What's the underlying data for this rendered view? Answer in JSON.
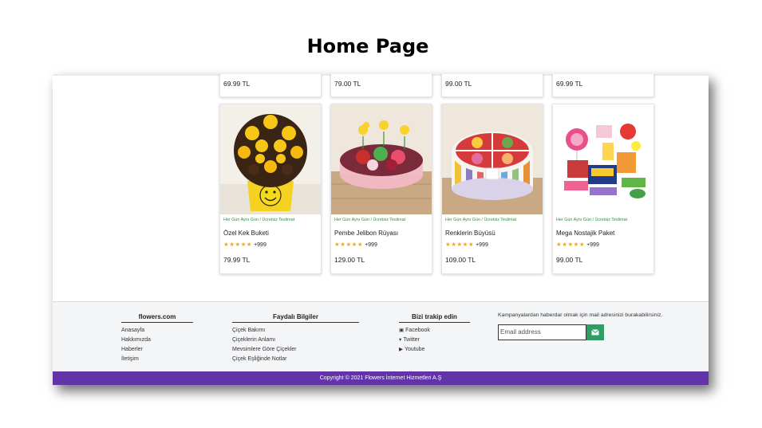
{
  "slide": {
    "title": "Home Page"
  },
  "top_row": [
    {
      "price": "69.99 TL"
    },
    {
      "price": "79.00 TL"
    },
    {
      "price": "99.00 TL"
    },
    {
      "price": "69.99 TL"
    }
  ],
  "products": [
    {
      "shipping": "Her Gün Aynı Gün / Ücretsiz Teslimat",
      "name": "Özel Kek Buketi",
      "stars": "★★★★★",
      "reviews": "+999",
      "price": "79.99 TL"
    },
    {
      "shipping": "Her Gün Aynı Gün / Ücretsiz Teslimat",
      "name": "Pembe Jelibon Rüyası",
      "stars": "★★★★★",
      "reviews": "+999",
      "price": "129.00 TL"
    },
    {
      "shipping": "Her Gün Aynı Gün / Ücretsiz Teslimat",
      "name": "Renklerin Büyüsü",
      "stars": "★★★★★",
      "reviews": "+999",
      "price": "109.00 TL"
    },
    {
      "shipping": "Her Gün Aynı Gün / Ücretsiz Teslimat",
      "name": "Mega Nostajik Paket",
      "stars": "★★★★★",
      "reviews": "+999",
      "price": "99.00 TL"
    }
  ],
  "footer": {
    "brand": {
      "title": "flowers.com",
      "links": [
        "Anasayfa",
        "Hakkımızda",
        "Haberler",
        "İletişim"
      ]
    },
    "useful": {
      "title": "Faydalı Bilgiler",
      "links": [
        "Çiçek Bakımı",
        "Çiçeklerin Anlamı",
        "Mevsimlere Göre Çiçekler",
        "Çiçek Eşliğinde Notlar"
      ]
    },
    "social": {
      "title": "Bizi trakip edin",
      "links": [
        "Facebook",
        "Twitter",
        "Youtube"
      ]
    },
    "newsletter": {
      "text": "Kampanyalardan haberdar olmak için mail adresinizi burakabilirsiniz.",
      "placeholder": "Email address",
      "icon": "envelope-icon"
    },
    "copyright": "Copyright © 2021 Flowers İnternet Hizmetleri A.Ş"
  },
  "colors": {
    "accent": "#6234a8",
    "ship_text": "#3a8a4a",
    "send_button": "#2e9e63",
    "stars": "#f5a623"
  }
}
